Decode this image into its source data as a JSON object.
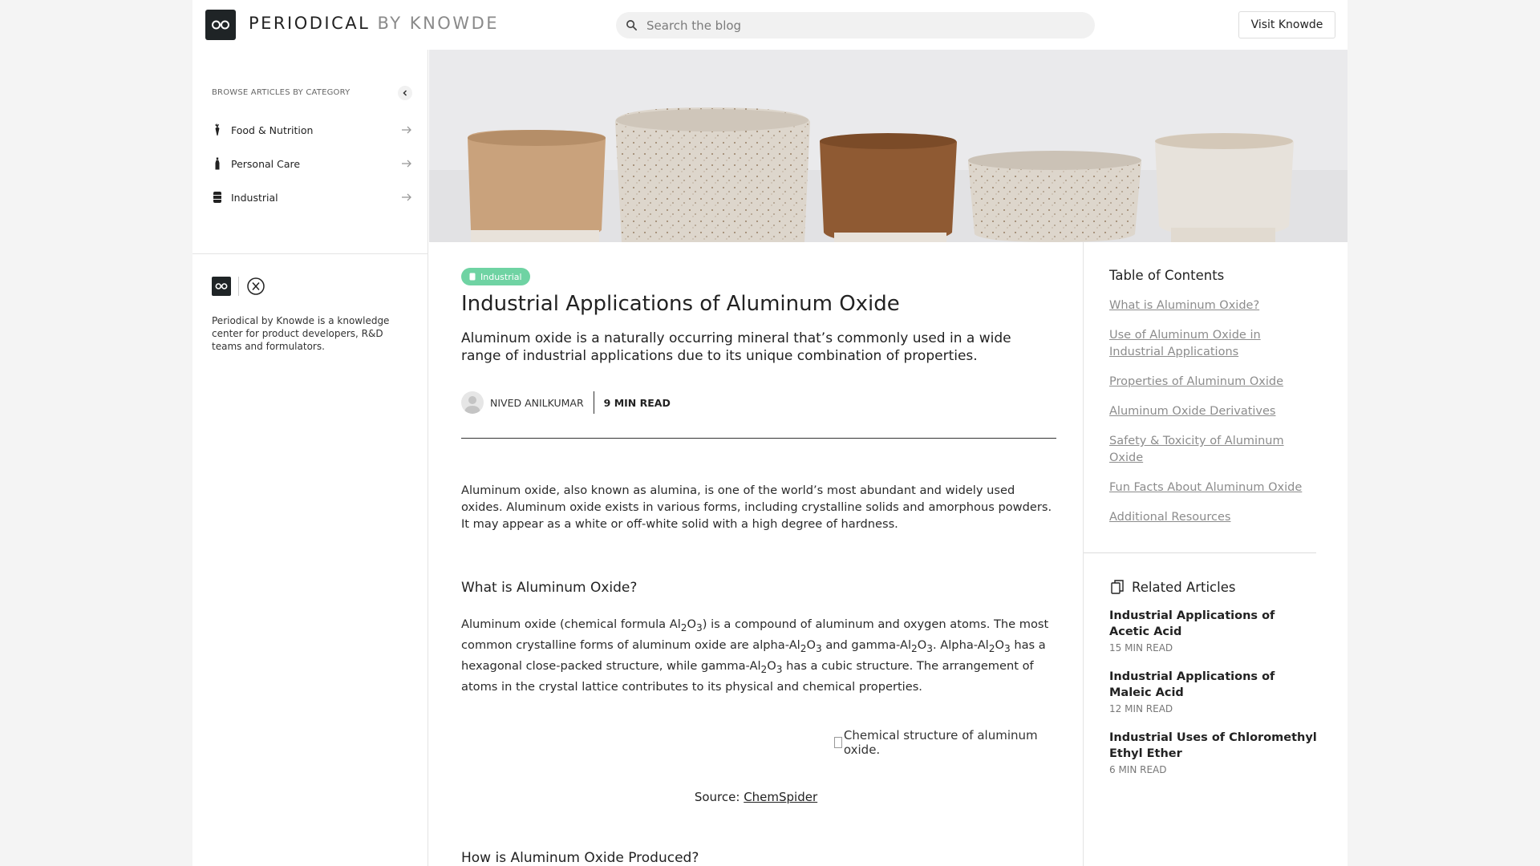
{
  "header": {
    "brand_primary": "PERIODICAL",
    "brand_secondary": "BY KNOWDE",
    "search_placeholder": "Search the blog",
    "visit_label": "Visit Knowde"
  },
  "sidebar": {
    "category_heading": "BROWSE ARTICLES BY CATEGORY",
    "categories": [
      {
        "label": "Food & Nutrition",
        "icon": "carrot-icon"
      },
      {
        "label": "Personal Care",
        "icon": "bottle-icon"
      },
      {
        "label": "Industrial",
        "icon": "barrel-icon"
      }
    ],
    "description": "Periodical by Knowde is a knowledge center for product developers, R&D teams and formulators."
  },
  "article": {
    "category_badge": "Industrial",
    "title": "Industrial Applications of Aluminum Oxide",
    "subtitle": "Aluminum oxide is a naturally occurring mineral that’s commonly used in a wide range of industrial applications due to its unique combination of properties.",
    "author": "NIVED ANILKUMAR",
    "read_time": "9 MIN READ",
    "intro": "Aluminum oxide, also known as alumina, is one of the world’s most abundant and widely used oxides. Aluminum oxide exists in various forms, including crystalline solids and amorphous powders. It may appear as a white or off-white solid with a high degree of hardness.",
    "section1_heading": "What is Aluminum Oxide?",
    "section1_body": {
      "t1": "Aluminum oxide (chemical formula Al",
      "t2": "O",
      "t3": ") is a compound of aluminum and oxygen atoms. The most common crystalline forms of aluminum oxide are alpha-Al",
      "t4": "O",
      "t5": " and gamma-Al",
      "t6": "O",
      "t7": ". Alpha-Al",
      "t8": "O",
      "t9": " has a hexagonal close-packed structure, while gamma-Al",
      "t10": "O",
      "t11": " has a cubic structure. The arrangement of atoms in the crystal lattice contributes to its physical and chemical properties.",
      "sub2": "2",
      "sub3": "3"
    },
    "image_alt": "Chemical structure of aluminum oxide.",
    "source_label": "Source: ",
    "source_link": "ChemSpider",
    "section2_heading": "How is Aluminum Oxide Produced?"
  },
  "toc": {
    "title": "Table of Contents",
    "items": [
      "What is Aluminum Oxide?",
      "Use of Aluminum Oxide in Industrial Applications",
      "Properties of Aluminum Oxide",
      "Aluminum Oxide Derivatives",
      "Safety & Toxicity of Aluminum Oxide",
      "Fun Facts About Aluminum Oxide",
      "Additional Resources"
    ]
  },
  "related": {
    "title": "Related Articles",
    "items": [
      {
        "title": "Industrial Applications of Acetic Acid",
        "read": "15 MIN READ"
      },
      {
        "title": "Industrial Applications of Maleic Acid",
        "read": "12 MIN READ"
      },
      {
        "title": "Industrial Uses of Chloromethyl Ethyl Ether",
        "read": "6 MIN READ"
      }
    ]
  },
  "colors": {
    "badge_green": "#6fd3a3",
    "logo_dark": "#1f2426",
    "toc_link_gray": "#8c8c8c"
  }
}
